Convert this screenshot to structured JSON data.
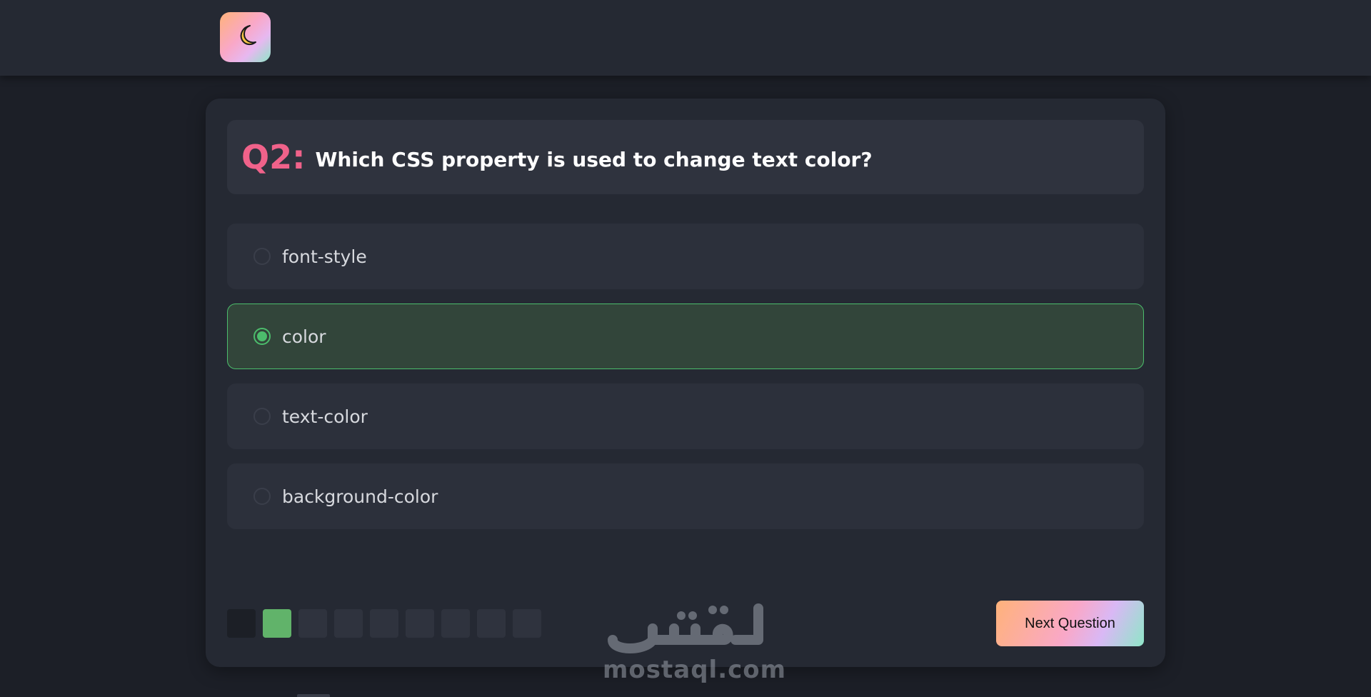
{
  "header": {
    "logo_icon": "crescent-moon-icon"
  },
  "question": {
    "number_label": "Q2:",
    "text": "Which CSS property is used to change text color?"
  },
  "options": [
    {
      "label": "font-style",
      "selected": false
    },
    {
      "label": "color",
      "selected": true
    },
    {
      "label": "text-color",
      "selected": false
    },
    {
      "label": "background-color",
      "selected": false
    }
  ],
  "progress": {
    "total": 9,
    "states": [
      "current",
      "answered",
      "pending",
      "pending",
      "pending",
      "pending",
      "pending",
      "pending",
      "pending"
    ]
  },
  "actions": {
    "next_label": "Next Question"
  },
  "watermark": {
    "arabic": "مستقل",
    "latin": "mostaql.com"
  },
  "colors": {
    "accent_pink": "#f0628a",
    "selected_green": "#4cbd6c",
    "answered_green": "#61b36a",
    "background": "#1c1f27",
    "card": "#252933"
  }
}
